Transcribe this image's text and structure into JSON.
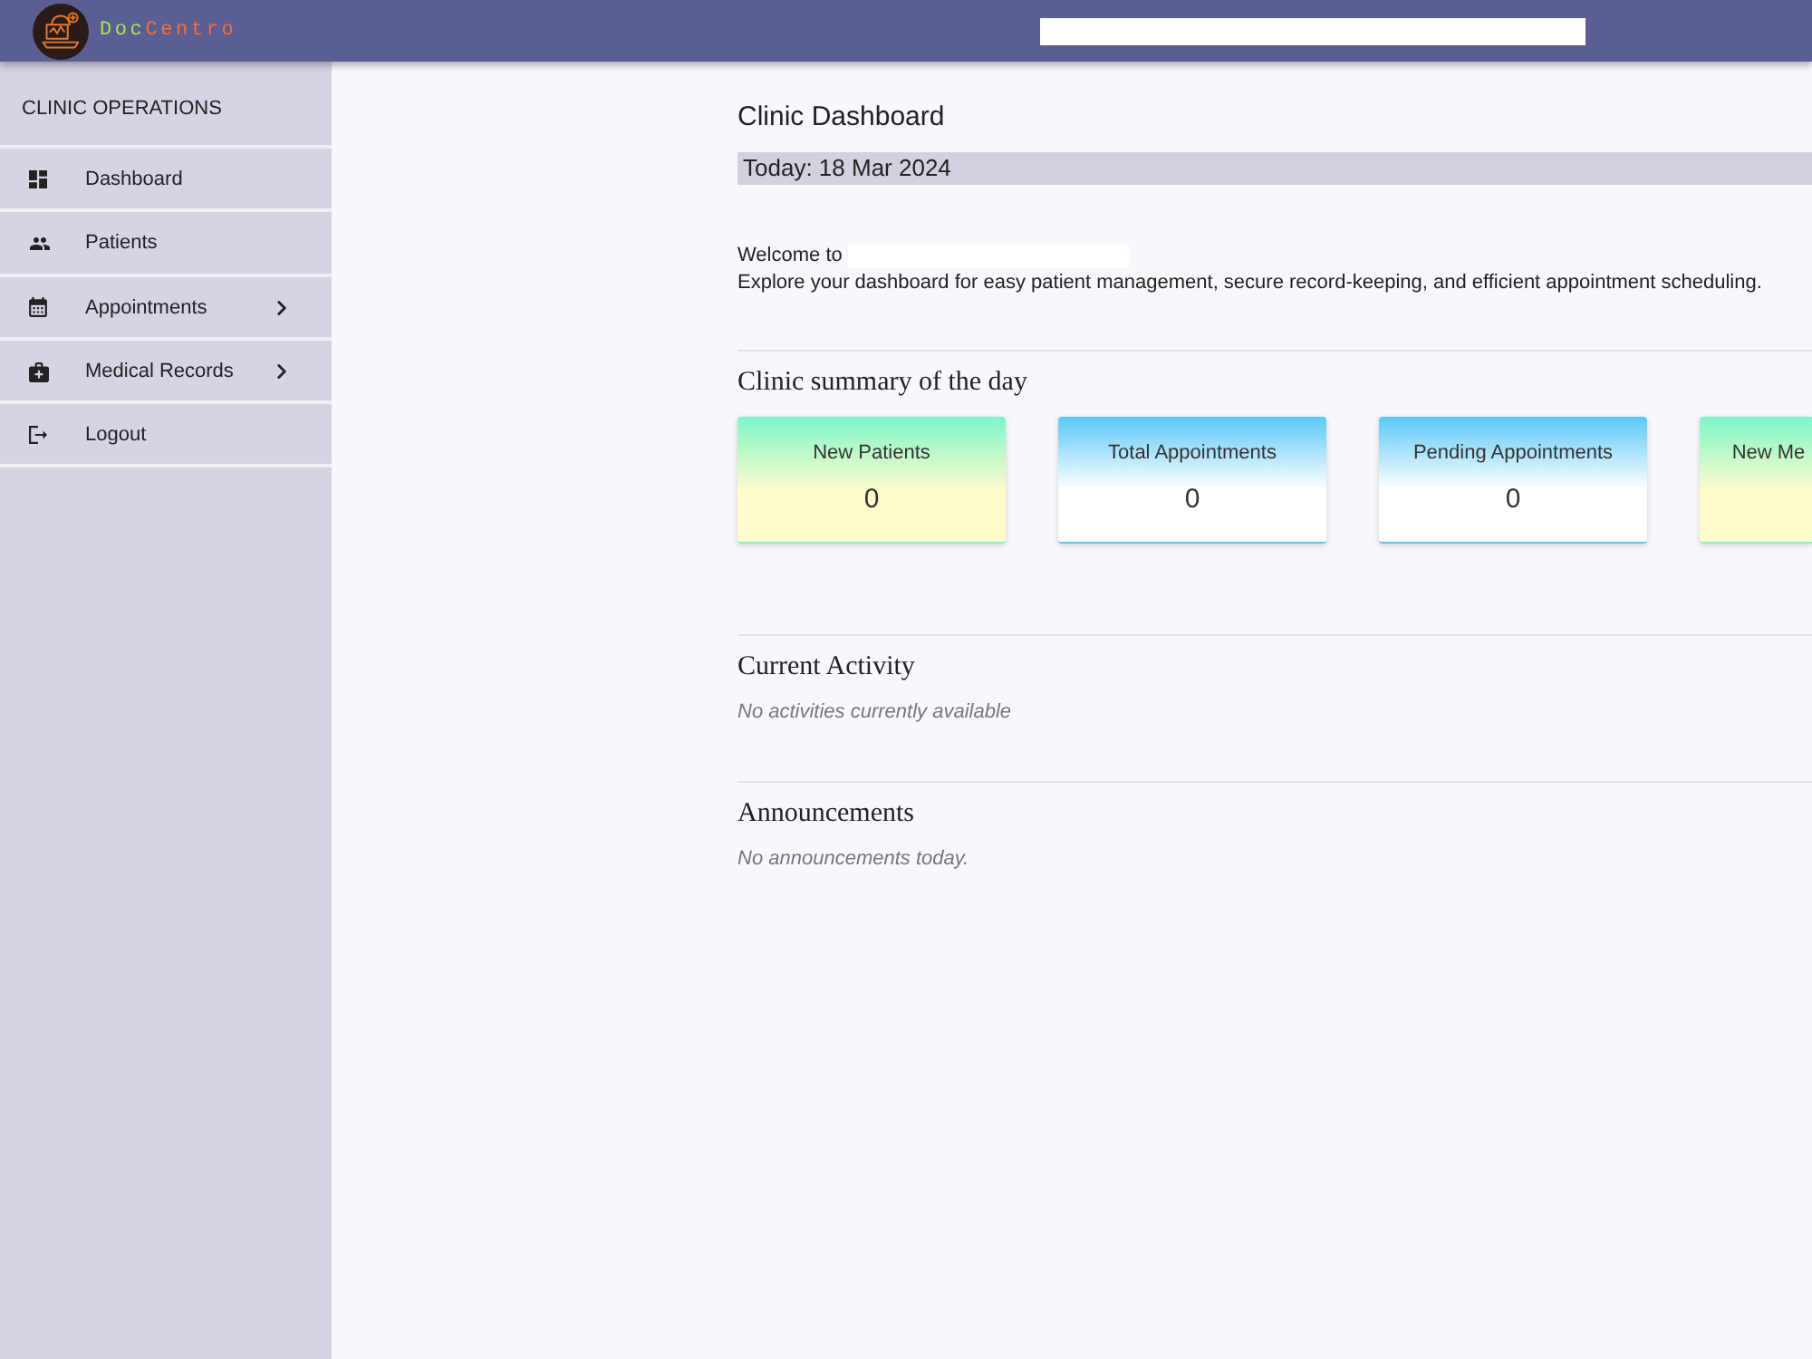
{
  "header": {
    "brand": [
      {
        "text": "Doc",
        "color": "#a3e35f"
      },
      {
        "text": "Centro",
        "color": "#f26d3d"
      }
    ]
  },
  "sidebar": {
    "title": "CLINIC OPERATIONS",
    "items": [
      {
        "label": "Dashboard",
        "kind": "link"
      },
      {
        "label": "Patients",
        "kind": "link"
      },
      {
        "label": "Appointments",
        "kind": "group"
      },
      {
        "label": "Medical Records",
        "kind": "group"
      },
      {
        "label": "Logout",
        "kind": "link"
      }
    ]
  },
  "main": {
    "title": "Clinic Dashboard",
    "date": "Today: 18 Mar 2024",
    "welcome": "Welcome to",
    "intro": "Explore your dashboard for easy patient management, secure record-keeping, and efficient appointment scheduling.",
    "summary": {
      "heading": "Clinic summary of the day",
      "cards": [
        {
          "label": "New Patients",
          "value": "0",
          "color": "#7ef5ca",
          "kind": "tinted"
        },
        {
          "label": "Total Appointments",
          "value": "0",
          "color": "#5bc8f7",
          "kind": "plain"
        },
        {
          "label": "Pending Appointments",
          "value": "0",
          "color": "#5bc8f7",
          "kind": "plain"
        },
        {
          "label": "New Me",
          "color": "#7ef5ca",
          "kind": "tinted"
        }
      ]
    },
    "activity": {
      "heading": "Current Activity",
      "empty_text": "No activities currently available"
    },
    "announcements": {
      "heading": "Announcements",
      "empty_text": "No announcements today."
    }
  }
}
